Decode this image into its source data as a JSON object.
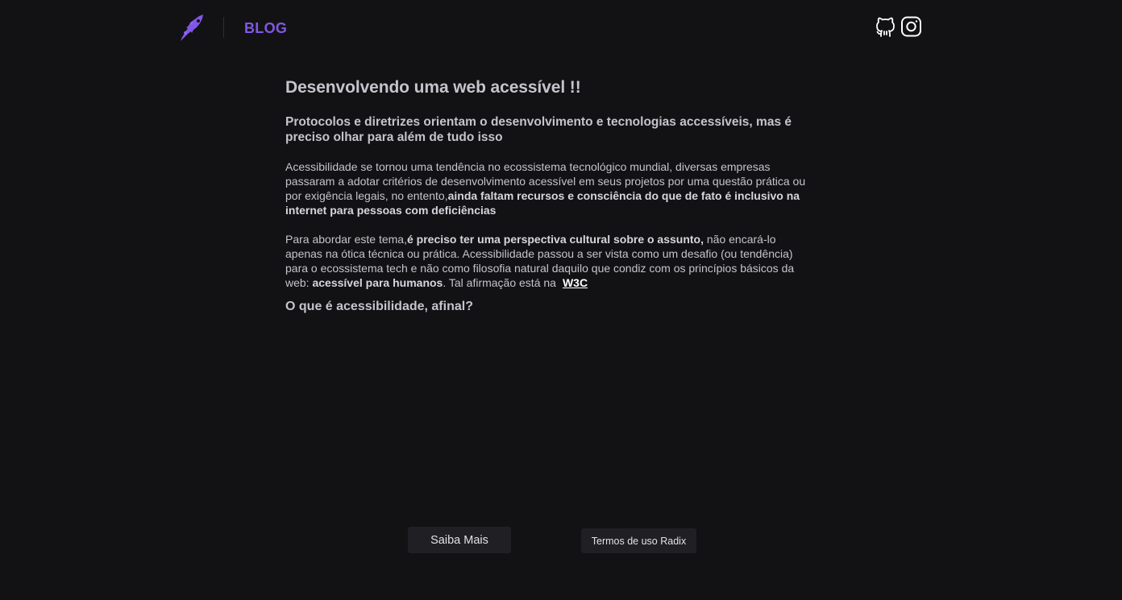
{
  "header": {
    "logo_icon": "rocket-logo-icon",
    "blog_label": "BLOG",
    "accent_color": "#8257e5",
    "social": [
      {
        "name": "github",
        "icon": "github-icon"
      },
      {
        "name": "instagram",
        "icon": "instagram-icon"
      }
    ]
  },
  "article": {
    "title": "Desenvolvendo uma web acessível !!",
    "subtitle": "Protocolos e diretrizes orientam o desenvolvimento e tecnologias accessíveis, mas é preciso olhar para além de tudo isso",
    "para1_normal": "Acessibilidade se tornou uma tendência no ecossistema tecnológico mundial, diversas empresas passaram a adotar critérios de desenvolvimento acessível em seus projetos por uma questão prática ou por exigência legais, no entento,",
    "para1_bold": "ainda faltam recursos e consciência do que de fato é inclusivo na internet para pessoas com deficiências",
    "para2_a": "Para abordar este tema,",
    "para2_b_bold": "é preciso ter uma perspectiva cultural sobre o assunto,",
    "para2_c": " não encará-lo apenas na ótica técnica ou prática. Acessibilidade passou a ser vista como um desafio (ou tendência) para o ecossistema tech e não como filosofia natural daquilo que condiz com os princípios básicos da web: ",
    "para2_d_bold": "acessível para humanos",
    "para2_e": ". Tal afirmação está na",
    "w3c_link": "W3C",
    "section_heading": "O que é acessibilidade, afinal?"
  },
  "footer": {
    "saiba_mais": "Saiba Mais",
    "termos": "Termos de uso Radix"
  }
}
